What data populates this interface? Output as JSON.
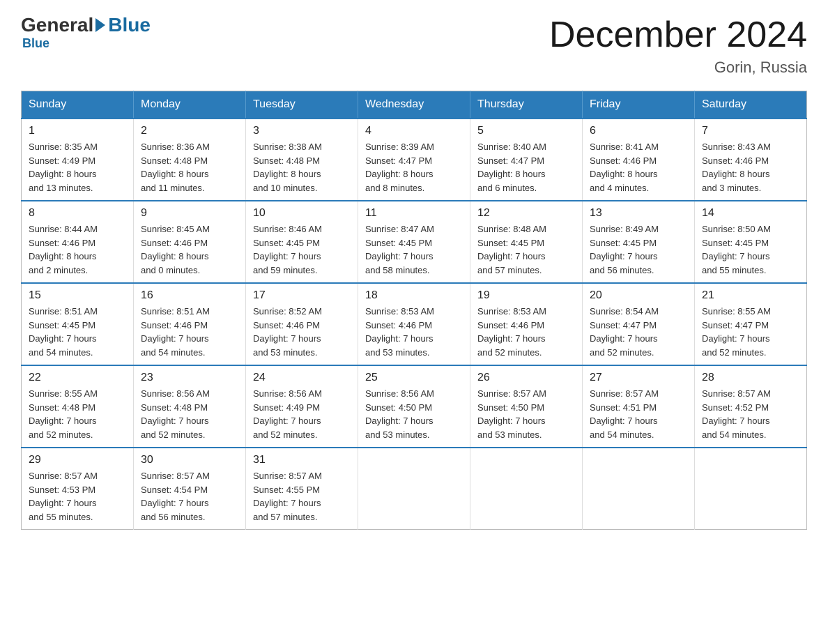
{
  "logo": {
    "general": "General",
    "blue": "Blue",
    "arrow": "▶"
  },
  "title": "December 2024",
  "subtitle": "Gorin, Russia",
  "days_of_week": [
    "Sunday",
    "Monday",
    "Tuesday",
    "Wednesday",
    "Thursday",
    "Friday",
    "Saturday"
  ],
  "weeks": [
    [
      {
        "day": "1",
        "info": "Sunrise: 8:35 AM\nSunset: 4:49 PM\nDaylight: 8 hours\nand 13 minutes."
      },
      {
        "day": "2",
        "info": "Sunrise: 8:36 AM\nSunset: 4:48 PM\nDaylight: 8 hours\nand 11 minutes."
      },
      {
        "day": "3",
        "info": "Sunrise: 8:38 AM\nSunset: 4:48 PM\nDaylight: 8 hours\nand 10 minutes."
      },
      {
        "day": "4",
        "info": "Sunrise: 8:39 AM\nSunset: 4:47 PM\nDaylight: 8 hours\nand 8 minutes."
      },
      {
        "day": "5",
        "info": "Sunrise: 8:40 AM\nSunset: 4:47 PM\nDaylight: 8 hours\nand 6 minutes."
      },
      {
        "day": "6",
        "info": "Sunrise: 8:41 AM\nSunset: 4:46 PM\nDaylight: 8 hours\nand 4 minutes."
      },
      {
        "day": "7",
        "info": "Sunrise: 8:43 AM\nSunset: 4:46 PM\nDaylight: 8 hours\nand 3 minutes."
      }
    ],
    [
      {
        "day": "8",
        "info": "Sunrise: 8:44 AM\nSunset: 4:46 PM\nDaylight: 8 hours\nand 2 minutes."
      },
      {
        "day": "9",
        "info": "Sunrise: 8:45 AM\nSunset: 4:46 PM\nDaylight: 8 hours\nand 0 minutes."
      },
      {
        "day": "10",
        "info": "Sunrise: 8:46 AM\nSunset: 4:45 PM\nDaylight: 7 hours\nand 59 minutes."
      },
      {
        "day": "11",
        "info": "Sunrise: 8:47 AM\nSunset: 4:45 PM\nDaylight: 7 hours\nand 58 minutes."
      },
      {
        "day": "12",
        "info": "Sunrise: 8:48 AM\nSunset: 4:45 PM\nDaylight: 7 hours\nand 57 minutes."
      },
      {
        "day": "13",
        "info": "Sunrise: 8:49 AM\nSunset: 4:45 PM\nDaylight: 7 hours\nand 56 minutes."
      },
      {
        "day": "14",
        "info": "Sunrise: 8:50 AM\nSunset: 4:45 PM\nDaylight: 7 hours\nand 55 minutes."
      }
    ],
    [
      {
        "day": "15",
        "info": "Sunrise: 8:51 AM\nSunset: 4:45 PM\nDaylight: 7 hours\nand 54 minutes."
      },
      {
        "day": "16",
        "info": "Sunrise: 8:51 AM\nSunset: 4:46 PM\nDaylight: 7 hours\nand 54 minutes."
      },
      {
        "day": "17",
        "info": "Sunrise: 8:52 AM\nSunset: 4:46 PM\nDaylight: 7 hours\nand 53 minutes."
      },
      {
        "day": "18",
        "info": "Sunrise: 8:53 AM\nSunset: 4:46 PM\nDaylight: 7 hours\nand 53 minutes."
      },
      {
        "day": "19",
        "info": "Sunrise: 8:53 AM\nSunset: 4:46 PM\nDaylight: 7 hours\nand 52 minutes."
      },
      {
        "day": "20",
        "info": "Sunrise: 8:54 AM\nSunset: 4:47 PM\nDaylight: 7 hours\nand 52 minutes."
      },
      {
        "day": "21",
        "info": "Sunrise: 8:55 AM\nSunset: 4:47 PM\nDaylight: 7 hours\nand 52 minutes."
      }
    ],
    [
      {
        "day": "22",
        "info": "Sunrise: 8:55 AM\nSunset: 4:48 PM\nDaylight: 7 hours\nand 52 minutes."
      },
      {
        "day": "23",
        "info": "Sunrise: 8:56 AM\nSunset: 4:48 PM\nDaylight: 7 hours\nand 52 minutes."
      },
      {
        "day": "24",
        "info": "Sunrise: 8:56 AM\nSunset: 4:49 PM\nDaylight: 7 hours\nand 52 minutes."
      },
      {
        "day": "25",
        "info": "Sunrise: 8:56 AM\nSunset: 4:50 PM\nDaylight: 7 hours\nand 53 minutes."
      },
      {
        "day": "26",
        "info": "Sunrise: 8:57 AM\nSunset: 4:50 PM\nDaylight: 7 hours\nand 53 minutes."
      },
      {
        "day": "27",
        "info": "Sunrise: 8:57 AM\nSunset: 4:51 PM\nDaylight: 7 hours\nand 54 minutes."
      },
      {
        "day": "28",
        "info": "Sunrise: 8:57 AM\nSunset: 4:52 PM\nDaylight: 7 hours\nand 54 minutes."
      }
    ],
    [
      {
        "day": "29",
        "info": "Sunrise: 8:57 AM\nSunset: 4:53 PM\nDaylight: 7 hours\nand 55 minutes."
      },
      {
        "day": "30",
        "info": "Sunrise: 8:57 AM\nSunset: 4:54 PM\nDaylight: 7 hours\nand 56 minutes."
      },
      {
        "day": "31",
        "info": "Sunrise: 8:57 AM\nSunset: 4:55 PM\nDaylight: 7 hours\nand 57 minutes."
      },
      {
        "day": "",
        "info": ""
      },
      {
        "day": "",
        "info": ""
      },
      {
        "day": "",
        "info": ""
      },
      {
        "day": "",
        "info": ""
      }
    ]
  ]
}
